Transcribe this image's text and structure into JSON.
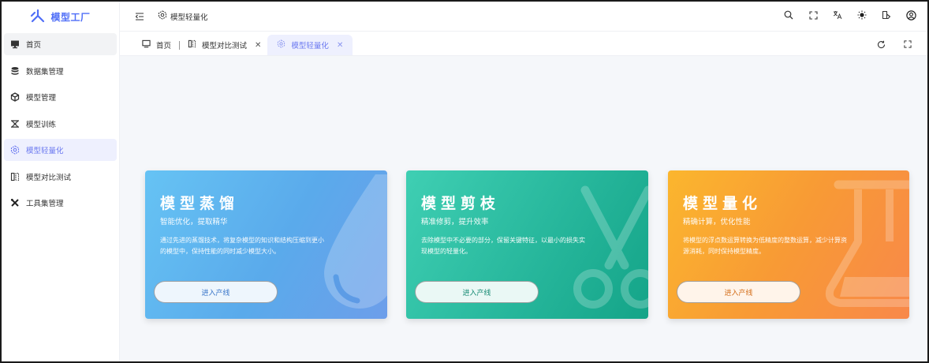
{
  "app": {
    "title": "模型工厂"
  },
  "colors": {
    "accent": "#4f6ef7",
    "active_bg": "#eef0fe",
    "card_distill": "#5aaaeb",
    "card_prune": "#27b79c",
    "card_quant": "#f89a35"
  },
  "sidebar": {
    "items": [
      {
        "label": "首页",
        "icon": "monitor-icon"
      },
      {
        "label": "数据集管理",
        "icon": "database-icon"
      },
      {
        "label": "模型管理",
        "icon": "cube-icon"
      },
      {
        "label": "模型训练",
        "icon": "train-icon"
      },
      {
        "label": "模型轻量化",
        "icon": "lightweight-icon"
      },
      {
        "label": "模型对比测试",
        "icon": "compare-icon"
      },
      {
        "label": "工具集管理",
        "icon": "tools-icon"
      }
    ]
  },
  "header": {
    "breadcrumb": "模型轻量化",
    "tools": [
      "search-icon",
      "fullscreen-icon",
      "translate-icon",
      "theme-sun-icon",
      "layout-icon",
      "user-icon"
    ]
  },
  "tabs": [
    {
      "label": "首页"
    },
    {
      "label": "模型对比测试"
    },
    {
      "label": "模型轻量化"
    }
  ],
  "cards": [
    {
      "title": "模型蒸馏",
      "subtitle": "智能优化，提取精华",
      "description": "通过先进的蒸馏技术，将复杂模型的知识和结构压缩到更小的模型中，保持性能的同时减少模型大小。",
      "button": "进入产线"
    },
    {
      "title": "模型剪枝",
      "subtitle": "精准修剪，提升效率",
      "description": "去除模型中不必要的部分，保留关键特征，以最小的损失实现模型的轻量化。",
      "button": "进入产线"
    },
    {
      "title": "模型量化",
      "subtitle": "精确计算，优化性能",
      "description": "将模型的浮点数运算转换为低精度的整数运算，减少计算资源消耗，同时保持模型精度。",
      "button": "进入产线"
    }
  ]
}
